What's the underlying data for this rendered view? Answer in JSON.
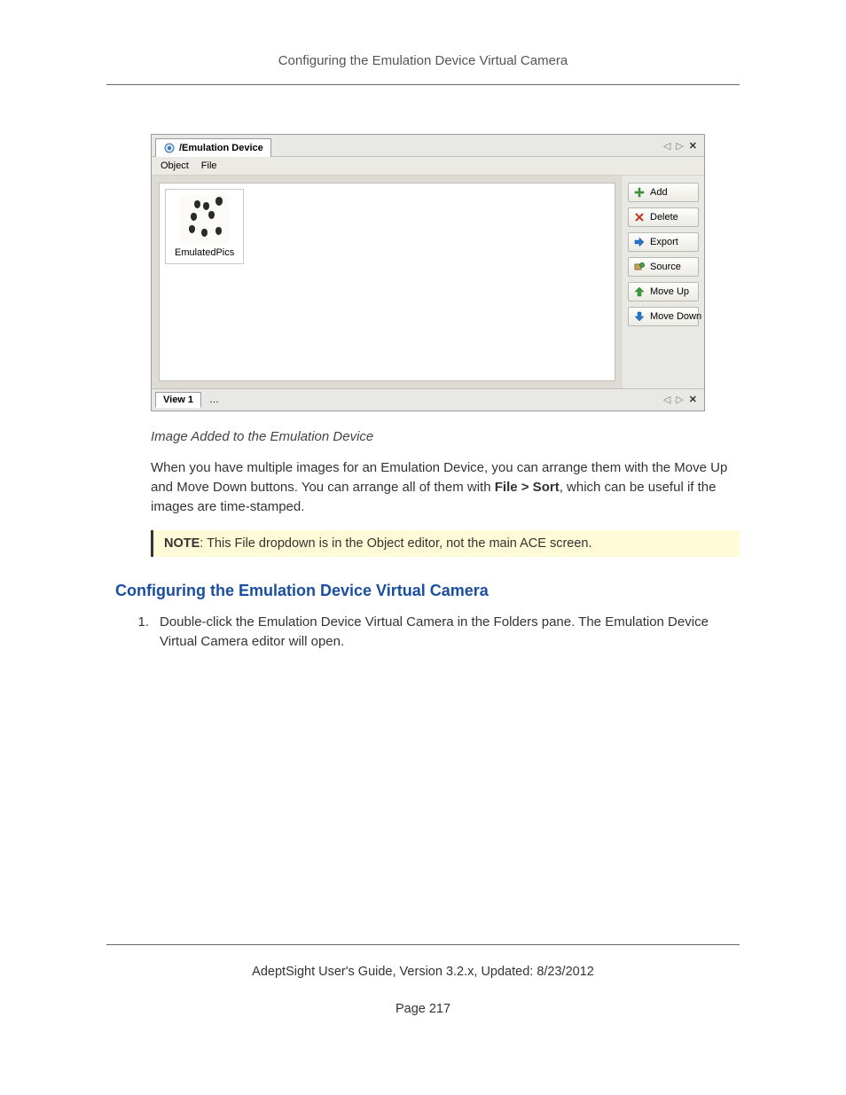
{
  "header": {
    "title": "Configuring the Emulation Device Virtual Camera"
  },
  "window": {
    "tab_title": "/Emulation Device",
    "menu": {
      "object": "Object",
      "file": "File"
    },
    "thumb_label": "EmulatedPics",
    "toolbar": {
      "add": "Add",
      "delete": "Delete",
      "export": "Export",
      "source": "Source",
      "move_up": "Move Up",
      "move_down": "Move Down"
    },
    "bottom_tab": "View 1",
    "bottom_dots": "…"
  },
  "caption": "Image Added to the Emulation Device",
  "para1a": "When you have multiple images for an Emulation Device, you can arrange them with the Move Up and Move Down buttons. You can arrange all of them with ",
  "para1b": "File > Sort",
  "para1c": ", which can be useful if the images are time-stamped.",
  "note_label": "NOTE",
  "note_text": ": This File dropdown is in the Object editor, not the main ACE screen.",
  "section_heading": "Configuring the Emulation Device Virtual Camera",
  "step1_num": "1.",
  "step1": "Double-click the Emulation Device Virtual Camera in the Folders pane. The Emulation Device Virtual Camera editor will open.",
  "footer_line": "AdeptSight User's Guide,  Version 3.2.x, Updated: 8/23/2012",
  "page_number": "Page 217"
}
